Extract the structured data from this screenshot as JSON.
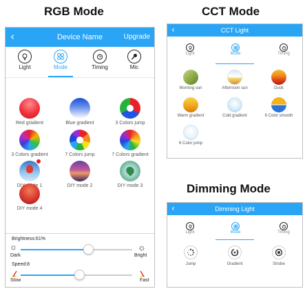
{
  "sections": {
    "rgb": "RGB Mode",
    "cct": "CCT Mode",
    "dimming": "Dimming Mode"
  },
  "rgb_screen": {
    "back_icon": "chevron-left-icon",
    "title": "Device Name",
    "upgrade": "Upgrade",
    "tabs": [
      {
        "label": "Light",
        "icon": "bulb-icon"
      },
      {
        "label": "Mode",
        "icon": "grid-icon",
        "active": true
      },
      {
        "label": "Timing",
        "icon": "alarm-clock-icon"
      },
      {
        "label": "Mic",
        "icon": "microphone-icon"
      }
    ],
    "modes": [
      {
        "label": "Red gradient"
      },
      {
        "label": "Blue gradient"
      },
      {
        "label": "3 Colors jump"
      },
      {
        "label": "3 Colors gradient"
      },
      {
        "label": "7 Colors jump"
      },
      {
        "label": "7 Colors gradient"
      },
      {
        "label": "DIY mode 1",
        "notification_dot": true
      },
      {
        "label": "DIY mode 2"
      },
      {
        "label": "DIY mode 3"
      },
      {
        "label": "DIY mode 4"
      }
    ],
    "brightness": {
      "label": "Brightness:61%",
      "value_percent": 61,
      "min_label": "Dark",
      "max_label": "Bright"
    },
    "speed": {
      "label": "Speed:8",
      "value_percent": 53,
      "min_label": "Slow",
      "max_label": "Fast"
    }
  },
  "cct_screen": {
    "back_icon": "chevron-left-icon",
    "title": "CCT Light",
    "tabs": [
      {
        "label": "Light",
        "icon": "bulb-icon"
      },
      {
        "label": "Mode",
        "icon": "grid-icon",
        "active": true
      },
      {
        "label": "Timing",
        "icon": "alarm-clock-icon"
      }
    ],
    "modes": [
      {
        "label": "Morning sun"
      },
      {
        "label": "Afternoon sun"
      },
      {
        "label": "Dusk"
      },
      {
        "label": "Warm gradient"
      },
      {
        "label": "Cold gradient"
      },
      {
        "label": "6 Color smooth"
      },
      {
        "label": "6 Color jump"
      }
    ]
  },
  "dimming_screen": {
    "back_icon": "chevron-left-icon",
    "title": "Dimming Light",
    "tabs": [
      {
        "label": "Light",
        "icon": "bulb-icon"
      },
      {
        "label": "Mode",
        "icon": "grid-icon",
        "active": true
      },
      {
        "label": "Timing",
        "icon": "alarm-clock-icon"
      }
    ],
    "modes": [
      {
        "label": "Jump"
      },
      {
        "label": "Gradient"
      },
      {
        "label": "Strobe"
      }
    ]
  },
  "colors": {
    "accent": "#2aa5f5",
    "notification": "#e81c1c"
  }
}
